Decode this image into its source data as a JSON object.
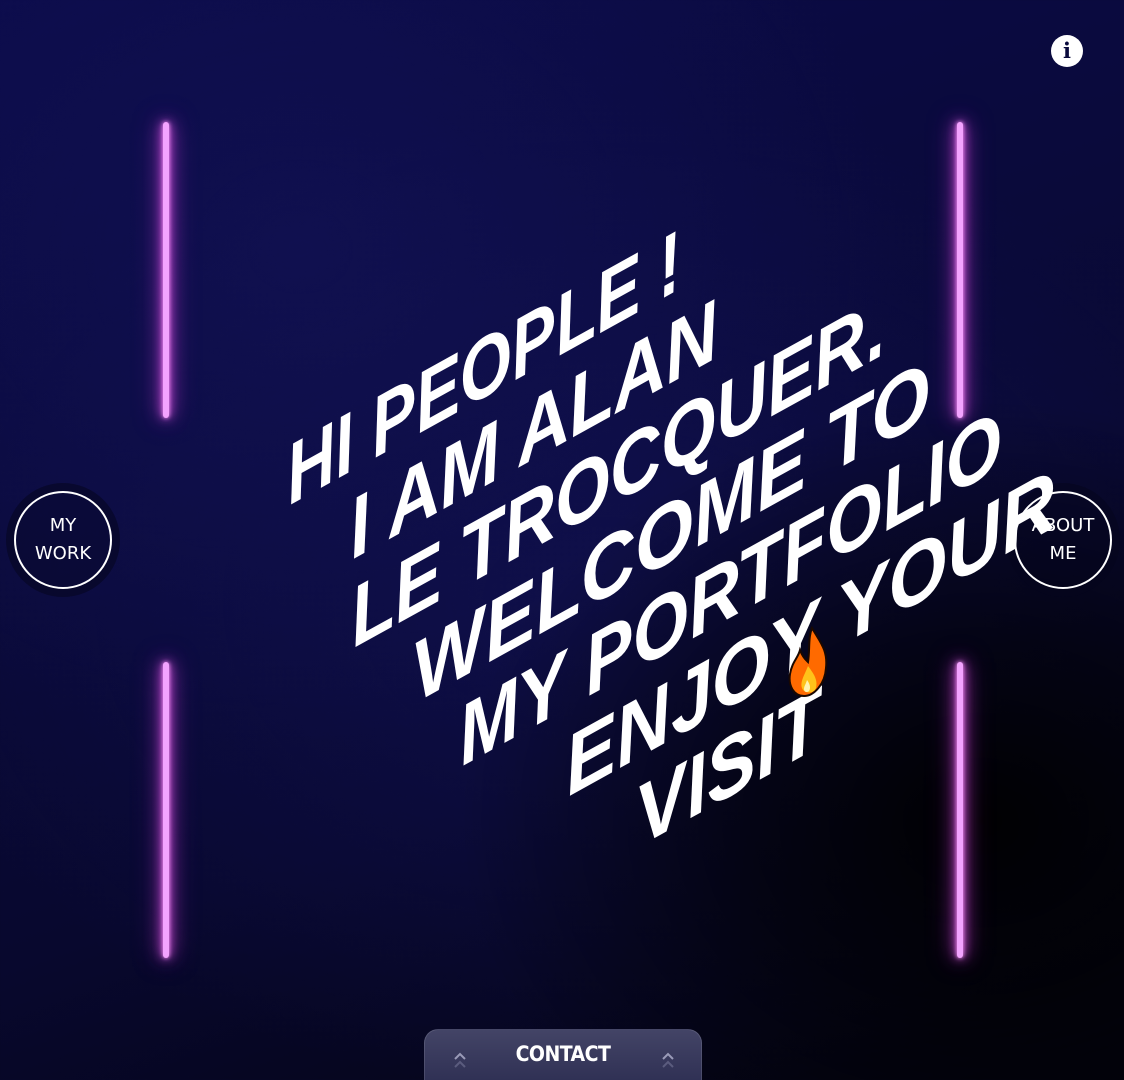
{
  "info_button": {
    "icon": "info-icon",
    "glyph": "i"
  },
  "nav": {
    "left": {
      "line1": "MY",
      "line2": "WORK"
    },
    "right": {
      "line1": "ABOUT",
      "line2": "ME"
    }
  },
  "hero": {
    "lines": [
      "HI PEOPLE !",
      "I AM ALAN",
      "LE TROCQUER.",
      "WELCOME TO",
      "MY PORTFOLIO",
      "ENJOY YOUR",
      "VISIT"
    ],
    "emoji": "🔥"
  },
  "contact": {
    "label": "CONTACT",
    "icon": "chevron-up-icon"
  },
  "colors": {
    "background": "#0a0a3c",
    "neon": "#e05ce8",
    "text": "#ffffff"
  }
}
